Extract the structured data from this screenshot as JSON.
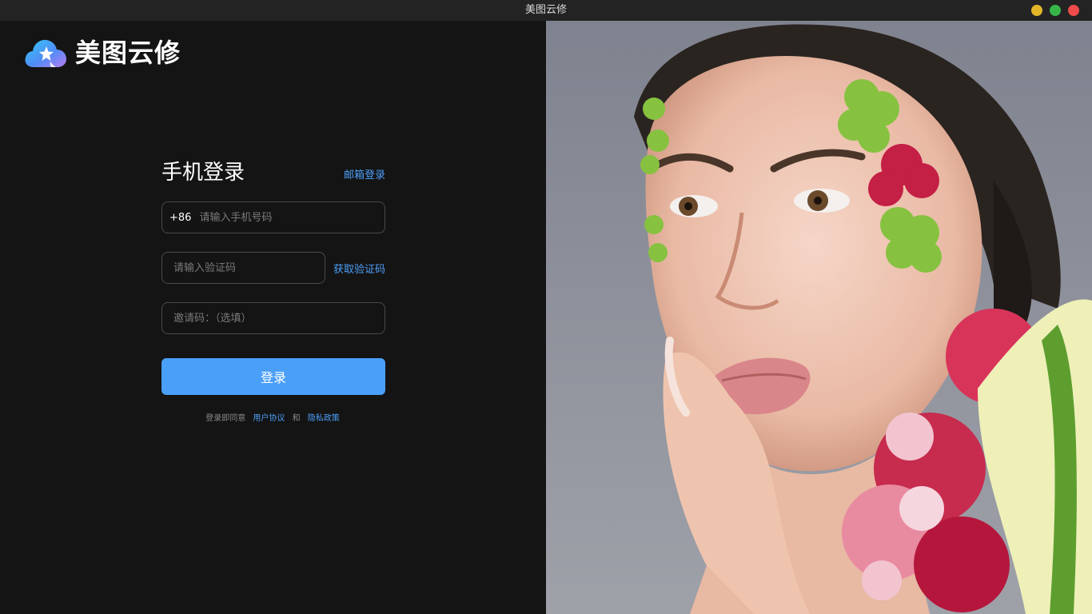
{
  "window": {
    "title": "美图云修",
    "controls": [
      "minimize",
      "maximize",
      "close"
    ],
    "colors": {
      "minimize": "#e3b62a",
      "maximize": "#38b549",
      "close": "#ef4b4b"
    }
  },
  "brand": {
    "logo_icon": "cloud-star-logo",
    "name": "美图云修"
  },
  "login": {
    "title": "手机登录",
    "switch_link": "邮箱登录",
    "phone": {
      "country_code": "+86",
      "placeholder": "请输入手机号码",
      "value": ""
    },
    "code": {
      "placeholder": "请输入验证码",
      "value": "",
      "get_code_link": "获取验证码"
    },
    "invite": {
      "placeholder": "邀请码：（选填）",
      "value": ""
    },
    "submit_label": "登录",
    "agreement": {
      "prefix": "登录即同意",
      "user_agreement": "用户协议",
      "and": "和",
      "privacy_policy": "隐私政策"
    }
  },
  "colors": {
    "accent": "#4a9ff8",
    "link": "#4d9ef7",
    "background": "#141414"
  }
}
